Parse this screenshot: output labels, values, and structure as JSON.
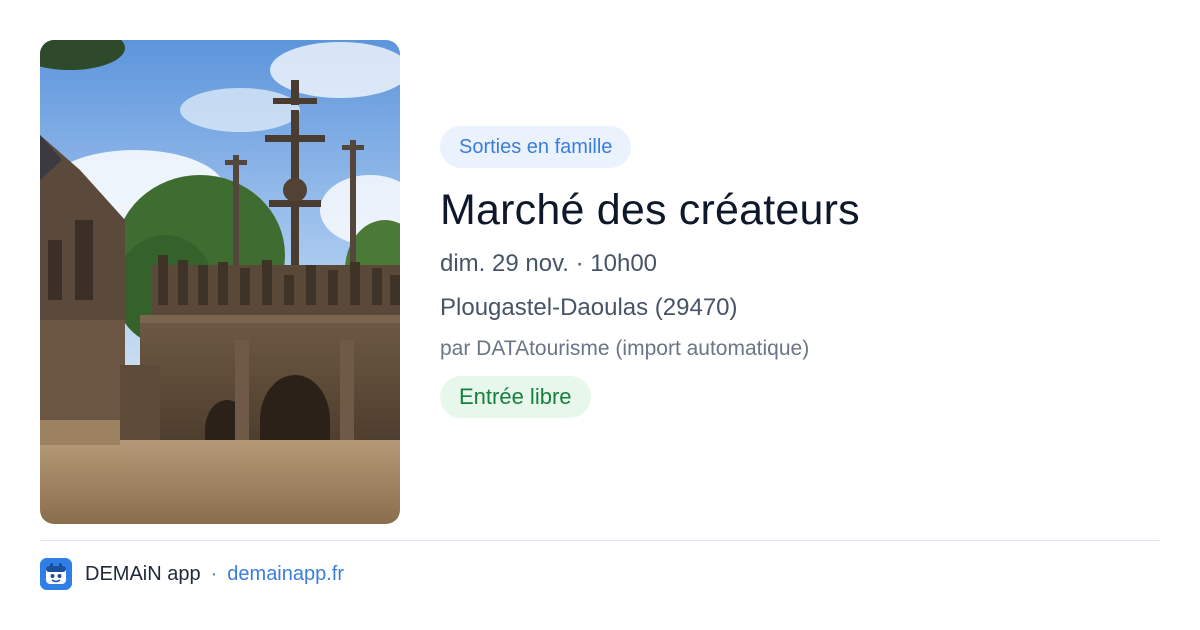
{
  "event": {
    "category": "Sorties en famille",
    "title": "Marché des créateurs",
    "datetime": "dim. 29 nov. · 10h00",
    "location": "Plougastel-Daoulas (29470)",
    "source": "par DATAtourisme (import automatique)",
    "price": "Entrée libre"
  },
  "footer": {
    "app_name": "DEMAiN app",
    "separator": "·",
    "site": "demainapp.fr",
    "app_icon": "demain-app-icon"
  },
  "colors": {
    "accent": "#3b7ddd",
    "category_bg": "#eaf2fd",
    "price_bg": "#e8f7ec",
    "price_text": "#18803f"
  }
}
